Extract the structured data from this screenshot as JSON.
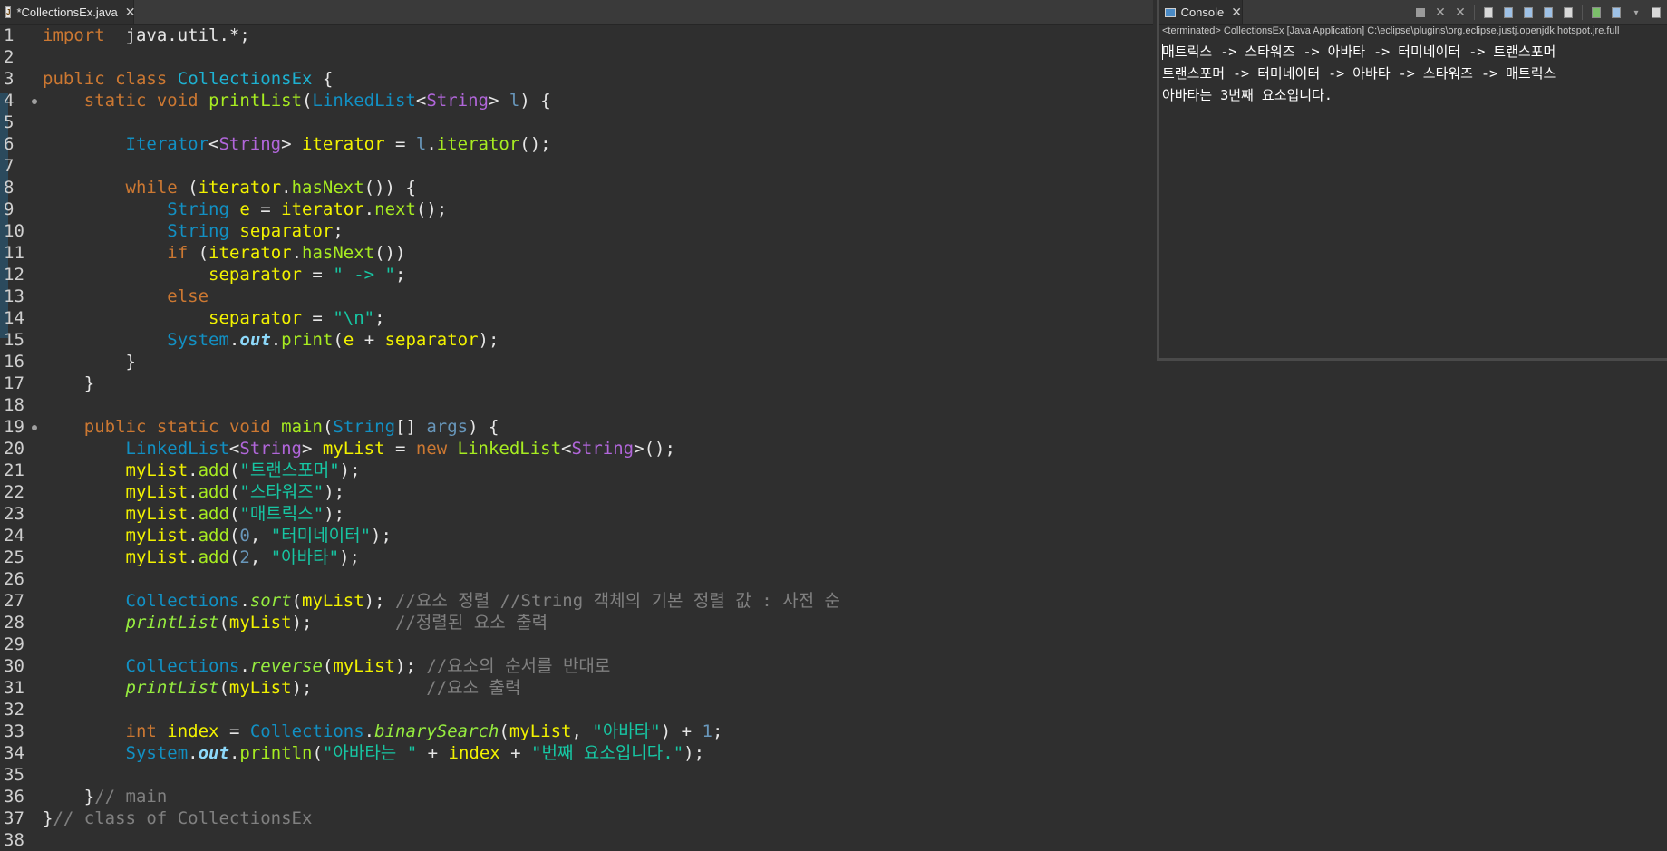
{
  "editor": {
    "tab_label": "*CollectionsEx.java",
    "file_icon_letter": "J",
    "close_glyph": "✕",
    "lines": [
      {
        "n": "1",
        "t": [
          [
            "kw",
            "import"
          ],
          [
            "",
            "  java.util.*;"
          ]
        ]
      },
      {
        "n": "2",
        "t": []
      },
      {
        "n": "3",
        "t": [
          [
            "kw",
            "public"
          ],
          [
            "",
            " "
          ],
          [
            "kw",
            "class"
          ],
          [
            "",
            " "
          ],
          [
            "cls",
            "CollectionsEx"
          ],
          [
            "",
            " {"
          ]
        ]
      },
      {
        "n": "4",
        "dot": true,
        "t": [
          [
            "",
            "    "
          ],
          [
            "kw",
            "static"
          ],
          [
            "",
            " "
          ],
          [
            "kw",
            "void"
          ],
          [
            "",
            " "
          ],
          [
            "met",
            "printList"
          ],
          [
            "",
            "("
          ],
          [
            "ty",
            "LinkedList"
          ],
          [
            "",
            "<"
          ],
          [
            "gen",
            "String"
          ],
          [
            "",
            "> "
          ],
          [
            "num",
            "l"
          ],
          [
            "",
            ") {"
          ]
        ]
      },
      {
        "n": "5",
        "t": []
      },
      {
        "n": "6",
        "t": [
          [
            "",
            "        "
          ],
          [
            "ty",
            "Iterator"
          ],
          [
            "",
            "<"
          ],
          [
            "gen",
            "String"
          ],
          [
            "",
            "> "
          ],
          [
            "var",
            "iterator"
          ],
          [
            "",
            " = "
          ],
          [
            "num",
            "l"
          ],
          [
            "",
            "."
          ],
          [
            "met",
            "iterator"
          ],
          [
            "",
            "();"
          ]
        ]
      },
      {
        "n": "7",
        "t": []
      },
      {
        "n": "8",
        "t": [
          [
            "",
            "        "
          ],
          [
            "kw",
            "while"
          ],
          [
            "",
            " ("
          ],
          [
            "var",
            "iterator"
          ],
          [
            "",
            "."
          ],
          [
            "met",
            "hasNext"
          ],
          [
            "",
            "()) {"
          ]
        ]
      },
      {
        "n": "9",
        "t": [
          [
            "",
            "            "
          ],
          [
            "ty",
            "String"
          ],
          [
            "",
            " "
          ],
          [
            "var",
            "e"
          ],
          [
            "",
            " = "
          ],
          [
            "var",
            "iterator"
          ],
          [
            "",
            "."
          ],
          [
            "met",
            "next"
          ],
          [
            "",
            "();"
          ]
        ]
      },
      {
        "n": "10",
        "t": [
          [
            "",
            "            "
          ],
          [
            "ty",
            "String"
          ],
          [
            "",
            " "
          ],
          [
            "var",
            "separator"
          ],
          [
            "",
            ";"
          ]
        ]
      },
      {
        "n": "11",
        "t": [
          [
            "",
            "            "
          ],
          [
            "kw",
            "if"
          ],
          [
            "",
            " ("
          ],
          [
            "var",
            "iterator"
          ],
          [
            "",
            "."
          ],
          [
            "met",
            "hasNext"
          ],
          [
            "",
            "())"
          ]
        ]
      },
      {
        "n": "12",
        "t": [
          [
            "",
            "                "
          ],
          [
            "var",
            "separator"
          ],
          [
            "",
            " = "
          ],
          [
            "str",
            "\" -> \""
          ],
          [
            "",
            ";"
          ]
        ]
      },
      {
        "n": "13",
        "t": [
          [
            "",
            "            "
          ],
          [
            "kw",
            "else"
          ]
        ]
      },
      {
        "n": "14",
        "t": [
          [
            "",
            "                "
          ],
          [
            "var",
            "separator"
          ],
          [
            "",
            " = "
          ],
          [
            "str",
            "\"\\n\""
          ],
          [
            "",
            ";"
          ]
        ]
      },
      {
        "n": "15",
        "t": [
          [
            "",
            "            "
          ],
          [
            "ty",
            "System"
          ],
          [
            "",
            "."
          ],
          [
            "sfld",
            "out"
          ],
          [
            "",
            "."
          ],
          [
            "met",
            "print"
          ],
          [
            "",
            "("
          ],
          [
            "var",
            "e"
          ],
          [
            "",
            " + "
          ],
          [
            "var",
            "separator"
          ],
          [
            "",
            ");"
          ]
        ]
      },
      {
        "n": "16",
        "t": [
          [
            "",
            "        }"
          ]
        ]
      },
      {
        "n": "17",
        "t": [
          [
            "",
            "    }"
          ]
        ]
      },
      {
        "n": "18",
        "t": []
      },
      {
        "n": "19",
        "dot": true,
        "t": [
          [
            "",
            "    "
          ],
          [
            "kw",
            "public"
          ],
          [
            "",
            " "
          ],
          [
            "kw",
            "static"
          ],
          [
            "",
            " "
          ],
          [
            "kw",
            "void"
          ],
          [
            "",
            " "
          ],
          [
            "met",
            "main"
          ],
          [
            "",
            "("
          ],
          [
            "ty",
            "String"
          ],
          [
            "",
            "[] "
          ],
          [
            "num",
            "args"
          ],
          [
            "",
            ") {"
          ]
        ]
      },
      {
        "n": "20",
        "t": [
          [
            "",
            "        "
          ],
          [
            "ty",
            "LinkedList"
          ],
          [
            "",
            "<"
          ],
          [
            "gen",
            "String"
          ],
          [
            "",
            "> "
          ],
          [
            "var",
            "myList"
          ],
          [
            "",
            " = "
          ],
          [
            "kw",
            "new"
          ],
          [
            "",
            " "
          ],
          [
            "met",
            "LinkedList"
          ],
          [
            "",
            "<"
          ],
          [
            "gen",
            "String"
          ],
          [
            "",
            ">();"
          ]
        ]
      },
      {
        "n": "21",
        "t": [
          [
            "",
            "        "
          ],
          [
            "var",
            "myList"
          ],
          [
            "",
            "."
          ],
          [
            "met",
            "add"
          ],
          [
            "",
            "("
          ],
          [
            "str",
            "\"트랜스포머\""
          ],
          [
            "",
            ");"
          ]
        ]
      },
      {
        "n": "22",
        "t": [
          [
            "",
            "        "
          ],
          [
            "var",
            "myList"
          ],
          [
            "",
            "."
          ],
          [
            "met",
            "add"
          ],
          [
            "",
            "("
          ],
          [
            "str",
            "\"스타워즈\""
          ],
          [
            "",
            ");"
          ]
        ]
      },
      {
        "n": "23",
        "t": [
          [
            "",
            "        "
          ],
          [
            "var",
            "myList"
          ],
          [
            "",
            "."
          ],
          [
            "met",
            "add"
          ],
          [
            "",
            "("
          ],
          [
            "str",
            "\"매트릭스\""
          ],
          [
            "",
            ");"
          ]
        ]
      },
      {
        "n": "24",
        "t": [
          [
            "",
            "        "
          ],
          [
            "var",
            "myList"
          ],
          [
            "",
            "."
          ],
          [
            "met",
            "add"
          ],
          [
            "",
            "("
          ],
          [
            "num",
            "0"
          ],
          [
            "",
            ", "
          ],
          [
            "str",
            "\"터미네이터\""
          ],
          [
            "",
            ");"
          ]
        ]
      },
      {
        "n": "25",
        "t": [
          [
            "",
            "        "
          ],
          [
            "var",
            "myList"
          ],
          [
            "",
            "."
          ],
          [
            "met",
            "add"
          ],
          [
            "",
            "("
          ],
          [
            "num",
            "2"
          ],
          [
            "",
            ", "
          ],
          [
            "str",
            "\"아바타\""
          ],
          [
            "",
            ");"
          ]
        ]
      },
      {
        "n": "26",
        "t": []
      },
      {
        "n": "27",
        "t": [
          [
            "",
            "        "
          ],
          [
            "ty",
            "Collections"
          ],
          [
            "",
            "."
          ],
          [
            "smet",
            "sort"
          ],
          [
            "",
            "("
          ],
          [
            "var",
            "myList"
          ],
          [
            "",
            "); "
          ],
          [
            "com",
            "//요소 정렬 //String 객체의 기본 정렬 값 : 사전 순"
          ]
        ]
      },
      {
        "n": "28",
        "t": [
          [
            "",
            "        "
          ],
          [
            "smet",
            "printList"
          ],
          [
            "",
            "("
          ],
          [
            "var",
            "myList"
          ],
          [
            "",
            ");        "
          ],
          [
            "com",
            "//정렬된 요소 출력"
          ]
        ]
      },
      {
        "n": "29",
        "t": []
      },
      {
        "n": "30",
        "t": [
          [
            "",
            "        "
          ],
          [
            "ty",
            "Collections"
          ],
          [
            "",
            "."
          ],
          [
            "smet",
            "reverse"
          ],
          [
            "",
            "("
          ],
          [
            "var",
            "myList"
          ],
          [
            "",
            "); "
          ],
          [
            "com",
            "//요소의 순서를 반대로"
          ]
        ]
      },
      {
        "n": "31",
        "t": [
          [
            "",
            "        "
          ],
          [
            "smet",
            "printList"
          ],
          [
            "",
            "("
          ],
          [
            "var",
            "myList"
          ],
          [
            "",
            ");           "
          ],
          [
            "com",
            "//요소 출력"
          ]
        ]
      },
      {
        "n": "32",
        "t": []
      },
      {
        "n": "33",
        "t": [
          [
            "",
            "        "
          ],
          [
            "kw",
            "int"
          ],
          [
            "",
            " "
          ],
          [
            "var",
            "index"
          ],
          [
            "",
            " = "
          ],
          [
            "ty",
            "Collections"
          ],
          [
            "",
            "."
          ],
          [
            "smet",
            "binarySearch"
          ],
          [
            "",
            "("
          ],
          [
            "var",
            "myList"
          ],
          [
            "",
            ", "
          ],
          [
            "str",
            "\"아바타\""
          ],
          [
            "",
            ") + "
          ],
          [
            "num",
            "1"
          ],
          [
            "",
            ";"
          ]
        ]
      },
      {
        "n": "34",
        "t": [
          [
            "",
            "        "
          ],
          [
            "ty",
            "System"
          ],
          [
            "",
            "."
          ],
          [
            "sfld",
            "out"
          ],
          [
            "",
            "."
          ],
          [
            "met",
            "println"
          ],
          [
            "",
            "("
          ],
          [
            "str",
            "\"아바타는 \""
          ],
          [
            "",
            " + "
          ],
          [
            "var",
            "index"
          ],
          [
            "",
            " + "
          ],
          [
            "str",
            "\"번째 요소입니다.\""
          ],
          [
            "",
            ");"
          ]
        ]
      },
      {
        "n": "35",
        "t": []
      },
      {
        "n": "36",
        "t": [
          [
            "",
            "    }"
          ],
          [
            "com",
            "// main"
          ]
        ]
      },
      {
        "n": "37",
        "t": [
          [
            "",
            "}"
          ],
          [
            "com",
            "// class of CollectionsEx"
          ]
        ]
      },
      {
        "n": "38",
        "t": []
      }
    ]
  },
  "console": {
    "tab_label": "Console",
    "close_glyph": "✕",
    "status": "<terminated> CollectionsEx [Java Application] C:\\eclipse\\plugins\\org.eclipse.justj.openjdk.hotspot.jre.full",
    "output": [
      "매트릭스 -> 스타워즈 -> 아바타 -> 터미네이터 -> 트랜스포머",
      "트랜스포머 -> 터미네이터 -> 아바타 -> 스타워즈 -> 매트릭스",
      "아바타는 3번째 요소입니다."
    ]
  }
}
